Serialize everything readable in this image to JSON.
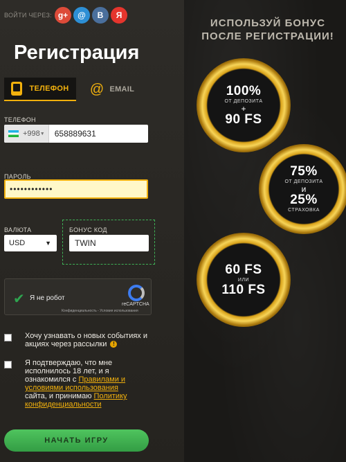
{
  "social": {
    "label": "ВОЙТИ ЧЕРЕЗ:",
    "buttons": [
      {
        "glyph": "g+",
        "color": "#dd4b39"
      },
      {
        "glyph": "@",
        "color": "#2d8fd5"
      },
      {
        "glyph": "В",
        "color": "#4a6f9c"
      },
      {
        "glyph": "Я",
        "color": "#e5352d"
      }
    ]
  },
  "form": {
    "title": "Регистрация",
    "tabs": {
      "phone": "ТЕЛЕФОН",
      "email": "EMAIL"
    },
    "phone": {
      "label": "ТЕЛЕФОН",
      "country_code": "+998",
      "value": "658889631"
    },
    "password": {
      "label": "ПАРОЛЬ",
      "value": "••••••••••••"
    },
    "currency": {
      "label": "ВАЛЮТА",
      "value": "USD"
    },
    "promo": {
      "label": "БОНУС КОД",
      "value": "TWIN"
    },
    "captcha": {
      "text": "Я не робот",
      "brand": "reCAPTCHA",
      "terms": "Конфиденциальность - Условия использования"
    },
    "newsletter": {
      "text": "Хочу узнавать о новых событиях и акциях через рассылки"
    },
    "terms": {
      "part1": "Я подтверждаю, что мне исполнилось 18 лет, и я ознакомился с ",
      "link1": "Правилами и условиями использования",
      "part2": " сайта, и принимаю ",
      "link2": "Политику конфиденциальности"
    },
    "submit": "НАЧАТЬ ИГРУ"
  },
  "promo": {
    "headline1": "ИСПОЛЬЗУЙ БОНУС",
    "headline2": "ПОСЛЕ РЕГИСТРАЦИИ!",
    "coin1": {
      "top": "100%",
      "mid": "ОТ ДЕПОЗИТА",
      "plus": "+",
      "bottom": "90 FS"
    },
    "coin2": {
      "top": "75%",
      "mid": "ОТ ДЕПОЗИТА",
      "plus": "и",
      "bottom": "25%",
      "small": "СТРАХОВКА"
    },
    "coin3": {
      "top": "60 FS",
      "mid": "ИЛИ",
      "bottom": "110 FS"
    }
  },
  "colors": {
    "accent": "#f2b10d",
    "submit": "#3fb257",
    "gold": "#d7a018"
  }
}
